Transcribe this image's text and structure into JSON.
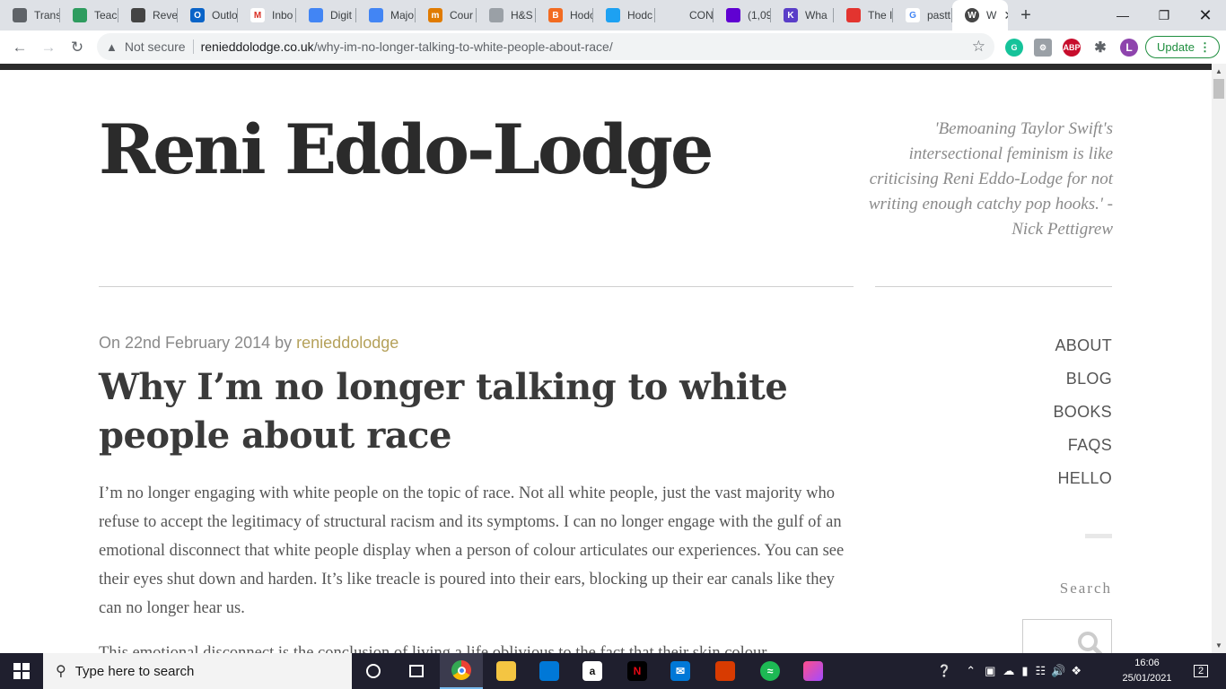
{
  "browser": {
    "tabs": [
      {
        "label": "Trans",
        "fav_color": "#5f6368",
        "icon": "globe-icon"
      },
      {
        "label": "Teacl",
        "fav_color": "#2e9c5f",
        "icon": "teacher-icon"
      },
      {
        "label": "Reve",
        "fav_color": "#444444",
        "icon": "cube-icon"
      },
      {
        "label": "Outlo",
        "fav_color": "#0a64c8",
        "icon": "outlook-icon",
        "glyph": "O"
      },
      {
        "label": "Inbo",
        "fav_color": "#ffffff",
        "icon": "gmail-icon",
        "glyph": "M"
      },
      {
        "label": "Digit",
        "fav_color": "#4285f4",
        "icon": "docs-icon"
      },
      {
        "label": "Majo",
        "fav_color": "#4285f4",
        "icon": "docs-icon"
      },
      {
        "label": "Cour",
        "fav_color": "#e07b00",
        "icon": "moodle-icon",
        "glyph": "m"
      },
      {
        "label": "H&S",
        "fav_color": "#9aa0a6",
        "icon": "page-icon"
      },
      {
        "label": "Hodc",
        "fav_color": "#f26b21",
        "icon": "blogger-icon",
        "glyph": "B"
      },
      {
        "label": "Hodc",
        "fav_color": "#1da1f2",
        "icon": "twitter-icon"
      },
      {
        "label": "CON",
        "fav_color": "#dee1e6",
        "icon": "blank-icon"
      },
      {
        "label": "(1,09",
        "fav_color": "#6001d2",
        "icon": "mail-icon"
      },
      {
        "label": "Wha",
        "fav_color": "#5a3ec8",
        "icon": "k-icon",
        "glyph": "K"
      },
      {
        "label": "The I",
        "fav_color": "#e3342f",
        "icon": "app-icon"
      },
      {
        "label": "pastt",
        "fav_color": "#ffffff",
        "icon": "google-icon",
        "glyph": "G"
      }
    ],
    "active_tab": {
      "label": "W",
      "icon": "wordpress-icon",
      "glyph": "W"
    },
    "address": {
      "security": "Not secure",
      "host": "renieddolodge.co.uk",
      "path": "/why-im-no-longer-talking-to-white-people-about-race/"
    },
    "update_label": "Update",
    "profile_initial": "L",
    "abp_label": "ABP"
  },
  "site": {
    "title": "Reni Eddo-Lodge",
    "tagline": "'Bemoaning Taylor Swift's intersectional feminism is like criticising Reni Eddo-Lodge for not writing enough catchy pop hooks.' - Nick Pettigrew"
  },
  "post": {
    "meta_prefix": "On 22nd February 2014 by",
    "author": "renieddolodge",
    "title": "Why I’m no longer talking to white people about race",
    "paragraph1": "I’m no longer engaging with white people on the topic of race. Not all white people, just the vast majority who refuse to accept the legitimacy of structural racism and its symptoms. I can no longer engage with the gulf of an emotional disconnect that white people display when a person of colour articulates our experiences. You can see their eyes shut down and harden. It’s like treacle is poured into their ears, blocking up their ear canals like they can no longer hear us.",
    "paragraph2": "This emotional disconnect is the conclusion of living a life oblivious to the fact that their skin colour"
  },
  "sidebar": {
    "menu": [
      "ABOUT",
      "BLOG",
      "BOOKS",
      "FAQS",
      "HELLO"
    ],
    "search_label": "Search"
  },
  "taskbar": {
    "search_placeholder": "Type here to search",
    "time": "16:06",
    "date": "25/01/2021",
    "notifications": "2"
  }
}
